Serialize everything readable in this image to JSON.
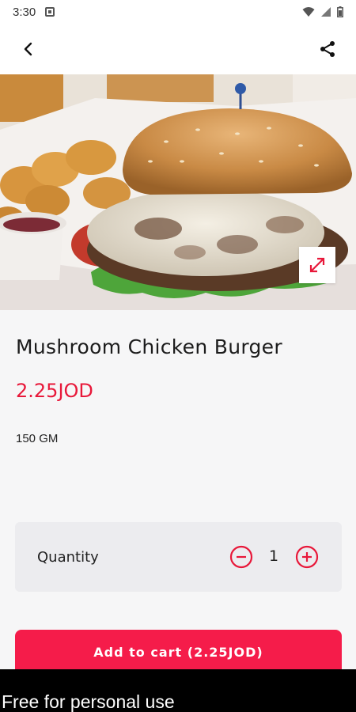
{
  "status_bar": {
    "time": "3:30",
    "icons": [
      "notification-icon",
      "wifi-icon",
      "signal-icon",
      "battery-icon"
    ]
  },
  "app_bar": {
    "back_icon": "chevron-left-icon",
    "share_icon": "share-icon"
  },
  "hero": {
    "image": "burger-photo",
    "expand_icon": "expand-icon"
  },
  "product": {
    "name": "Mushroom Chicken Burger",
    "price": "2.25JOD",
    "weight": "150 GM"
  },
  "quantity": {
    "label": "Quantity",
    "value": "1",
    "minus_icon": "minus-circle-icon",
    "plus_icon": "plus-circle-icon"
  },
  "cart": {
    "button_label": "Add to cart (2.25JOD)"
  },
  "footer": {
    "watermark": "Free for personal use"
  },
  "colors": {
    "accent": "#e8183a",
    "button": "#f51c4a",
    "background": "#f6f6f7",
    "card": "#ececef"
  }
}
